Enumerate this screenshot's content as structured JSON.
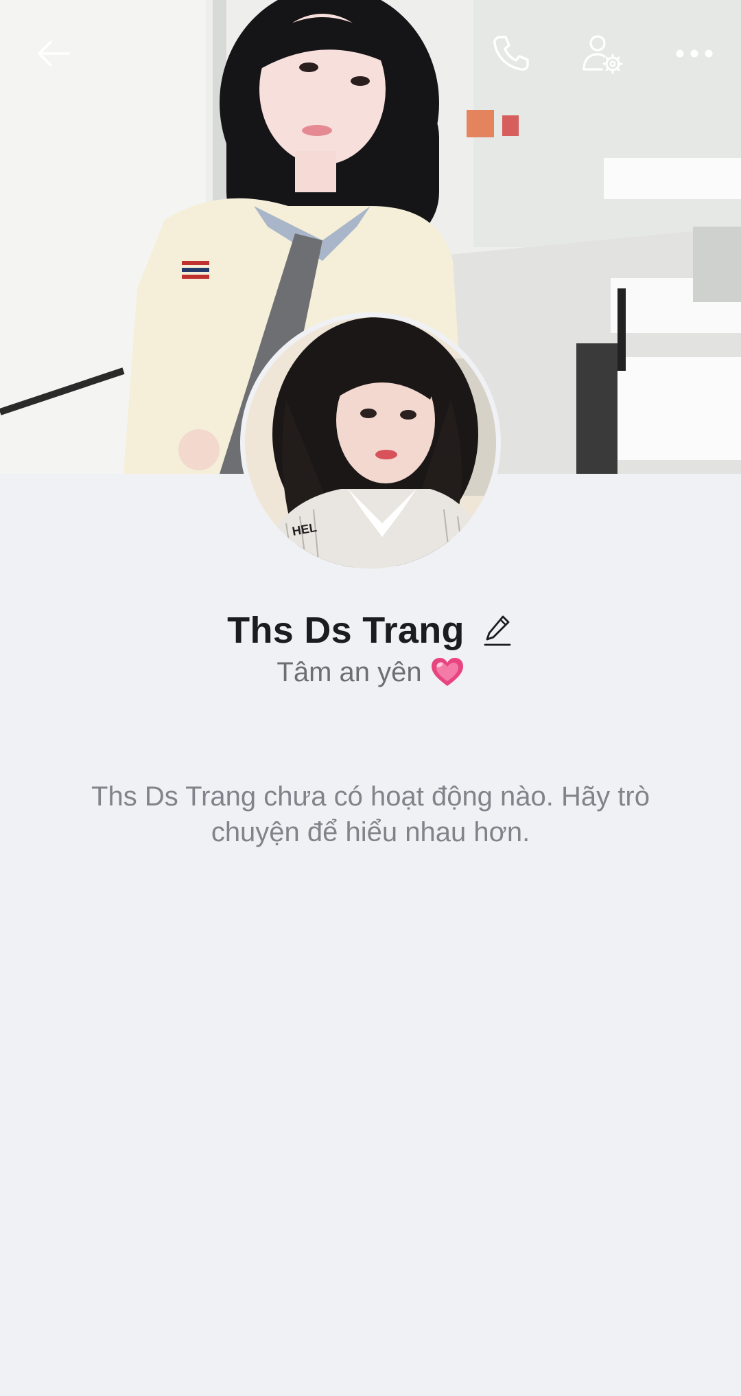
{
  "header": {
    "back_icon": "arrow-left-icon",
    "call_icon": "phone-icon",
    "settings_icon": "user-settings-icon",
    "more_icon": "more-horizontal-icon"
  },
  "profile": {
    "name": "Ths Ds Trang",
    "edit_icon": "pencil-icon",
    "status_text": "Tâm an yên",
    "status_emoji_icon": "pink-heart-icon"
  },
  "feed": {
    "empty_message": "Ths Ds Trang chưa có hoạt động nào. Hãy trò chuyện để hiểu nhau hơn."
  },
  "colors": {
    "background": "#f0f1f5",
    "name_text": "#1a1c20",
    "secondary_text": "#6b6e73",
    "heart": "#e8457f"
  }
}
